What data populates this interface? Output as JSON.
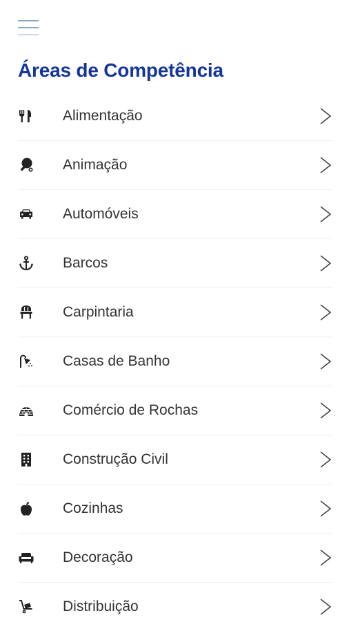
{
  "header": {
    "title": "Áreas de Competência"
  },
  "items": [
    {
      "label": "Alimentação",
      "icon": "utensils-icon"
    },
    {
      "label": "Animação",
      "icon": "ping-pong-icon"
    },
    {
      "label": "Automóveis",
      "icon": "car-icon"
    },
    {
      "label": "Barcos",
      "icon": "anchor-icon"
    },
    {
      "label": "Carpintaria",
      "icon": "chair-icon"
    },
    {
      "label": "Casas de Banho",
      "icon": "shower-icon"
    },
    {
      "label": "Comércio de Rochas",
      "icon": "igloo-icon"
    },
    {
      "label": "Construção Civil",
      "icon": "building-icon"
    },
    {
      "label": "Cozinhas",
      "icon": "apple-icon"
    },
    {
      "label": "Decoração",
      "icon": "couch-icon"
    },
    {
      "label": "Distribuição",
      "icon": "dolly-icon"
    }
  ],
  "colors": {
    "title": "#14359a",
    "menu": "#8aa6c8",
    "text": "#333333",
    "chevron": "#444444"
  }
}
